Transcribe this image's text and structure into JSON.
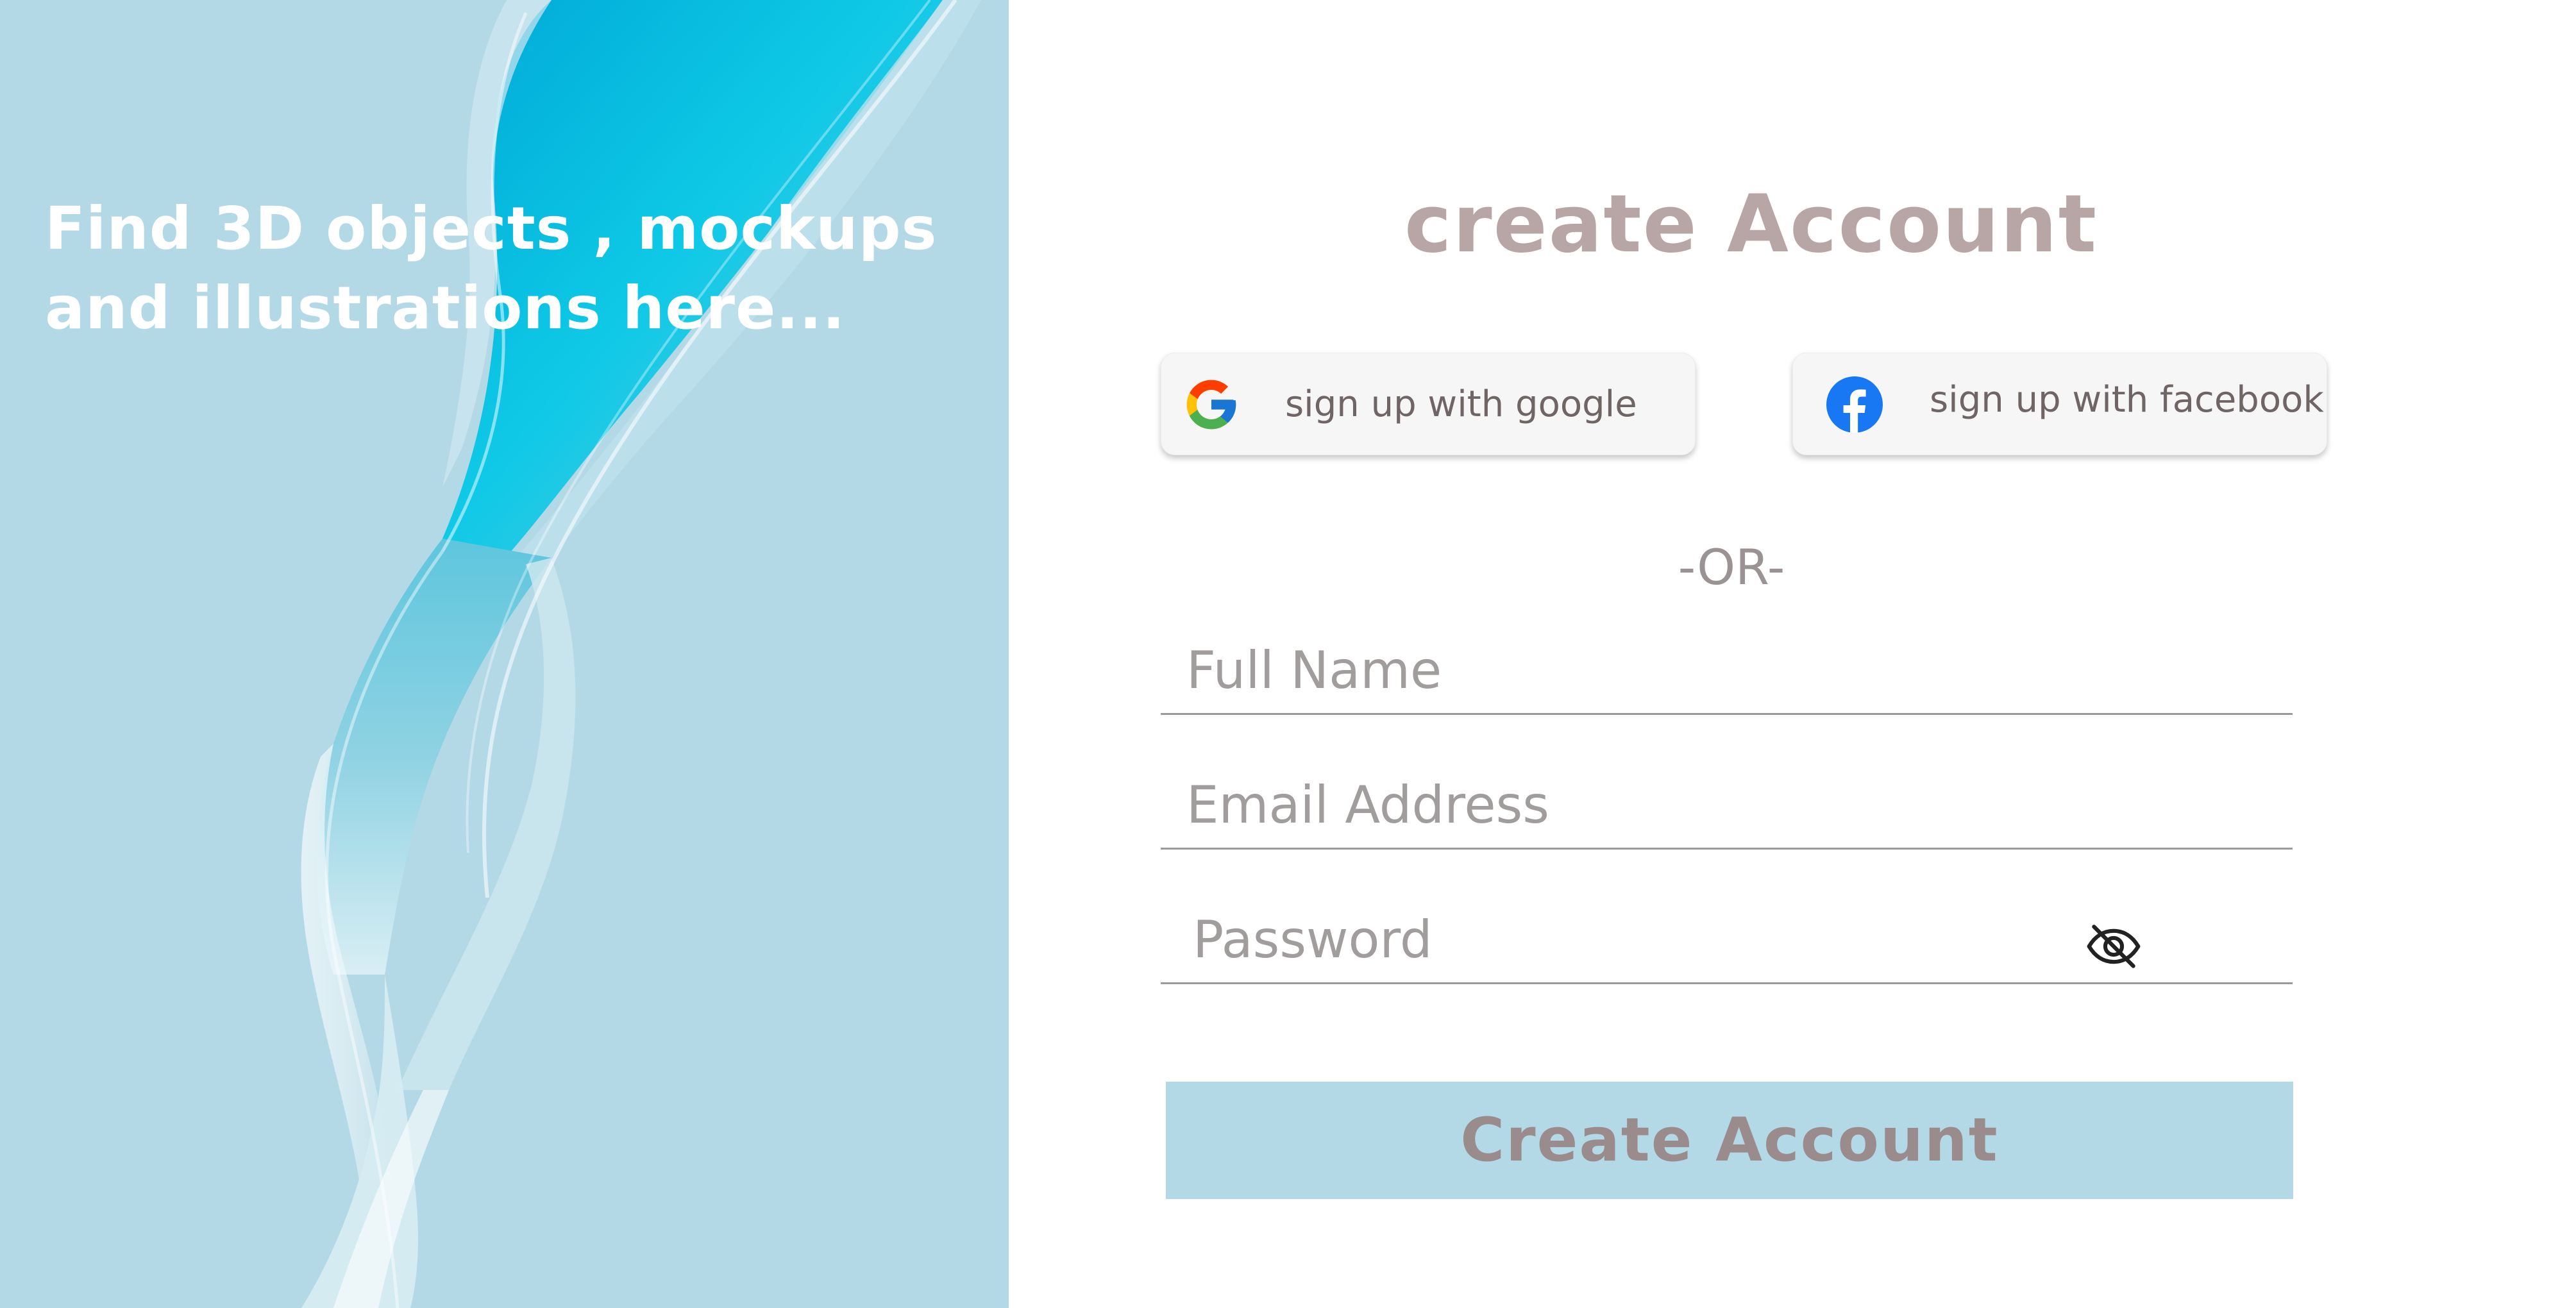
{
  "hero": {
    "tagline": "Find 3D objects , mockups and illustrations here...",
    "background_color": "#b4d9e6"
  },
  "form": {
    "title": "create Account",
    "title_color": "#b8a6a6",
    "social": {
      "google_label": "sign up with google",
      "google_icon": "google-logo-icon",
      "facebook_label": "sign up with facebook",
      "facebook_icon": "facebook-logo-icon"
    },
    "divider": "-OR-",
    "fields": {
      "full_name_placeholder": "Full Name",
      "email_placeholder": "Email Address",
      "password_placeholder": "Password",
      "password_toggle_icon": "eye-slash-icon"
    },
    "submit_label": "Create Account",
    "submit_color": "#b4d9e6"
  }
}
